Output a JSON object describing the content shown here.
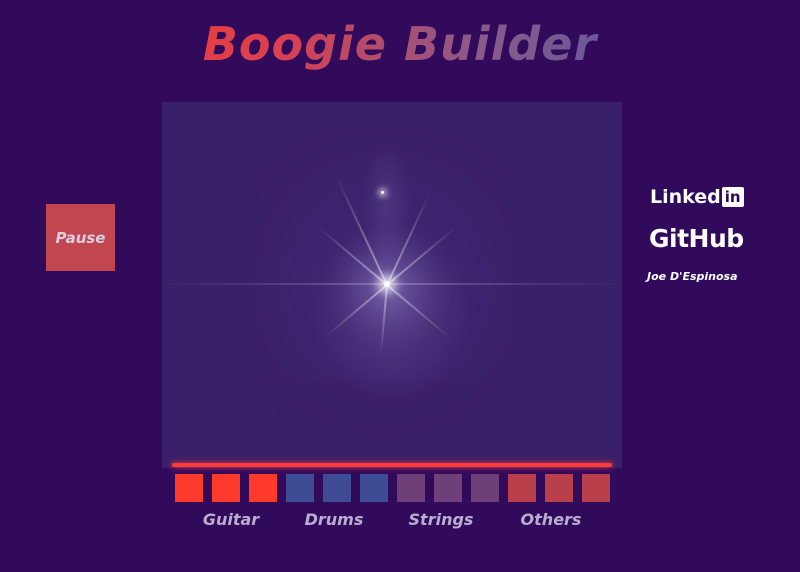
{
  "title": "Boogie Builder",
  "pause_button": "Pause",
  "links": {
    "linkedin_text": "Linked",
    "linkedin_box": "in",
    "github": "GitHub",
    "author": "Joe D'Espinosa"
  },
  "groups": [
    {
      "label": "Guitar",
      "color": "#ff3a2a"
    },
    {
      "label": "Drums",
      "color": "#3e4c94"
    },
    {
      "label": "Strings",
      "color": "#6e3f78"
    },
    {
      "label": "Others",
      "color": "#b9404a"
    }
  ],
  "colors": {
    "background": "#310a5c",
    "stage": "#3a2068",
    "track_line": "#ff3a3a",
    "pause_button": "#c24650"
  }
}
